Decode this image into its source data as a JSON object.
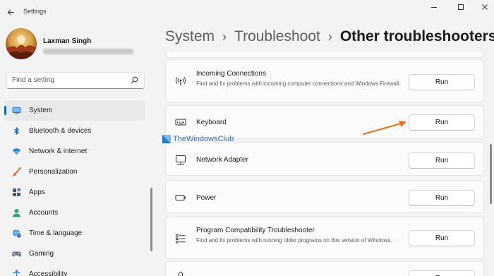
{
  "window": {
    "title": "Settings",
    "back_icon": "back-arrow-icon",
    "controls": [
      "minimize-icon",
      "maximize-icon",
      "close-icon"
    ]
  },
  "user": {
    "name": "Laxman Singh",
    "avatar_icon": "avatar-photo"
  },
  "search": {
    "placeholder": "Find a setting",
    "icon": "search-icon"
  },
  "nav": {
    "active": "System",
    "items": [
      {
        "label": "System",
        "icon": "monitor-icon"
      },
      {
        "label": "Bluetooth & devices",
        "icon": "bluetooth-icon"
      },
      {
        "label": "Network & internet",
        "icon": "wifi-icon"
      },
      {
        "label": "Personalization",
        "icon": "brush-icon"
      },
      {
        "label": "Apps",
        "icon": "apps-icon"
      },
      {
        "label": "Accounts",
        "icon": "person-icon"
      },
      {
        "label": "Time & language",
        "icon": "globe-clock-icon"
      },
      {
        "label": "Gaming",
        "icon": "gamepad-icon"
      },
      {
        "label": "Accessibility",
        "icon": "accessibility-icon"
      }
    ]
  },
  "breadcrumb": {
    "parts": [
      "System",
      "Troubleshoot"
    ],
    "current": "Other troubleshooters",
    "separator": "›"
  },
  "troubleshooters": [
    {
      "title": "Incoming Connections",
      "description": "Find and fix problems with incoming computer connections and Windows Firewall.",
      "button": "Run",
      "icon": "broadcast-icon"
    },
    {
      "title": "Keyboard",
      "description": "",
      "button": "Run",
      "icon": "keyboard-icon"
    },
    {
      "title": "Network Adapter",
      "description": "",
      "button": "Run",
      "icon": "network-adapter-icon"
    },
    {
      "title": "Power",
      "description": "",
      "button": "Run",
      "icon": "battery-icon"
    },
    {
      "title": "Program Compatibility Troubleshooter",
      "description": "Find and fix problems with running older programs on this version of Windows.",
      "button": "Run",
      "icon": "program-list-icon"
    },
    {
      "title": "",
      "description": "",
      "button": "Run",
      "icon": "recording-icon"
    }
  ],
  "watermark": {
    "text": "TheWindowsClub",
    "icon": "windows-club-logo-icon"
  },
  "annotation": {
    "icon": "orange-arrow-icon",
    "color": "#e8721c"
  },
  "colors": {
    "accent": "#0f6cbd",
    "background": "#f3f3f3",
    "card": "#fbfbfb"
  }
}
